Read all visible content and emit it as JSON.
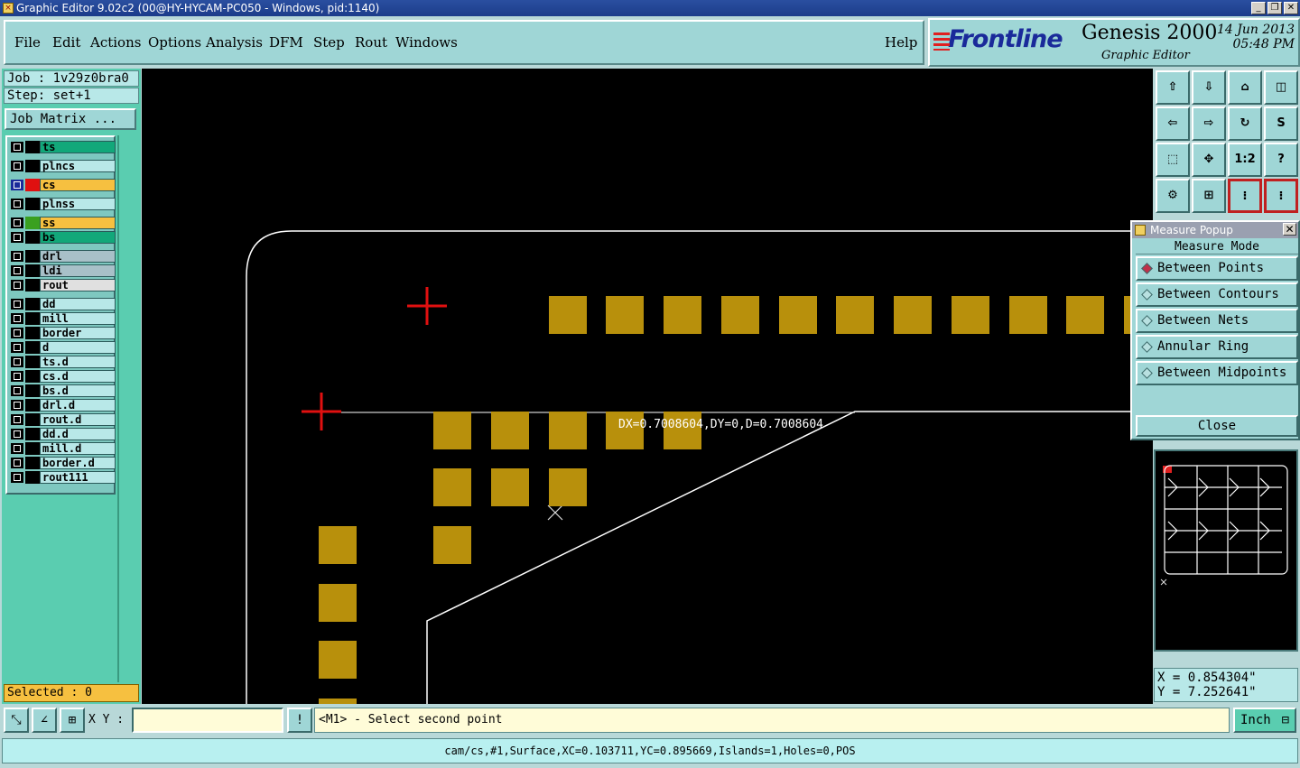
{
  "window": {
    "title": "Graphic Editor 9.02c2 (00@HY-HYCAM-PC050 - Windows, pid:1140)"
  },
  "menu": [
    {
      "label": "File"
    },
    {
      "label": "Edit"
    },
    {
      "label": "Actions"
    },
    {
      "label": "Options"
    },
    {
      "label": "Analysis"
    },
    {
      "label": "DFM"
    },
    {
      "label": "Step"
    },
    {
      "label": "Rout"
    },
    {
      "label": "Windows"
    }
  ],
  "help_label": "Help",
  "logo": {
    "brand": "Frontline",
    "product": "Genesis 2000",
    "module": "Graphic Editor",
    "date": "14 Jun 2013",
    "time": "05:48 PM"
  },
  "job": {
    "job_line": "Job : 1v29z0bra0",
    "step_line": "Step: set+1",
    "matrix_button": "Job Matrix ..."
  },
  "layers": [
    {
      "name": "ts",
      "color": "#12a87a"
    },
    {
      "name": "plncs",
      "color": "#b8e8e8"
    },
    {
      "name": "cs",
      "color": "#f6c040"
    },
    {
      "name": "plnss",
      "color": "#b8e8e8"
    },
    {
      "name": "ss",
      "color": "#f6c040"
    },
    {
      "name": "bs",
      "color": "#12a87a"
    },
    {
      "name": "drl",
      "color": "#a8c0c8"
    },
    {
      "name": "ldi",
      "color": "#a8c0c8"
    },
    {
      "name": "rout",
      "color": "#e0e0e0"
    },
    {
      "name": "dd",
      "color": "#b8e8e8"
    },
    {
      "name": "mill",
      "color": "#b8e8e8"
    },
    {
      "name": "border",
      "color": "#b8e8e8"
    },
    {
      "name": "d",
      "color": "#b8e8e8"
    },
    {
      "name": "ts.d",
      "color": "#b8e8e8"
    },
    {
      "name": "cs.d",
      "color": "#b8e8e8"
    },
    {
      "name": "bs.d",
      "color": "#b8e8e8"
    },
    {
      "name": "drl.d",
      "color": "#b8e8e8"
    },
    {
      "name": "rout.d",
      "color": "#b8e8e8"
    },
    {
      "name": "dd.d",
      "color": "#b8e8e8"
    },
    {
      "name": "mill.d",
      "color": "#b8e8e8"
    },
    {
      "name": "border.d",
      "color": "#b8e8e8"
    },
    {
      "name": "rout111",
      "color": "#b8e8e8"
    }
  ],
  "selected_text": "Selected : 0",
  "canvas": {
    "measure_label": "DX=0.7008604,DY=0,D=0.7008604",
    "pad_color": "#b8900c",
    "outline_color": "#ffffff",
    "cursor_color": "#e01010"
  },
  "toolbar_icons": [
    "home-up-icon",
    "home-down-icon",
    "home-icon",
    "window-xy-icon",
    "pan-left-icon",
    "pan-right-icon",
    "rotate-icon",
    "route-icon",
    "fit-all-icon",
    "fit-center-icon",
    "scale-1-2-icon",
    "help-icon",
    "settings-icon",
    "grid-icon",
    "layer-view-icon",
    "layer-view-2-icon"
  ],
  "toolbar_scale_label": "1:2",
  "toolbar_help_label": "?",
  "measure_popup": {
    "title": "Measure Popup",
    "mode_label": "Measure Mode",
    "options": [
      {
        "label": "Between Points",
        "selected": true
      },
      {
        "label": "Between Contours",
        "selected": false
      },
      {
        "label": "Between Nets",
        "selected": false
      },
      {
        "label": "Annular Ring",
        "selected": false
      },
      {
        "label": "Between Midpoints",
        "selected": false
      }
    ],
    "close_label": "Close"
  },
  "coords": {
    "x": "X = 0.854304\"",
    "y": "Y = 7.252641\""
  },
  "bottom": {
    "xy_label": "X Y :",
    "xy_value": "",
    "prompt": "<M1> - Select second point",
    "unit": "Inch"
  },
  "status_line": "cam/cs,#1,Surface,XC=0.103711,YC=0.895669,Islands=1,Holes=0,POS"
}
